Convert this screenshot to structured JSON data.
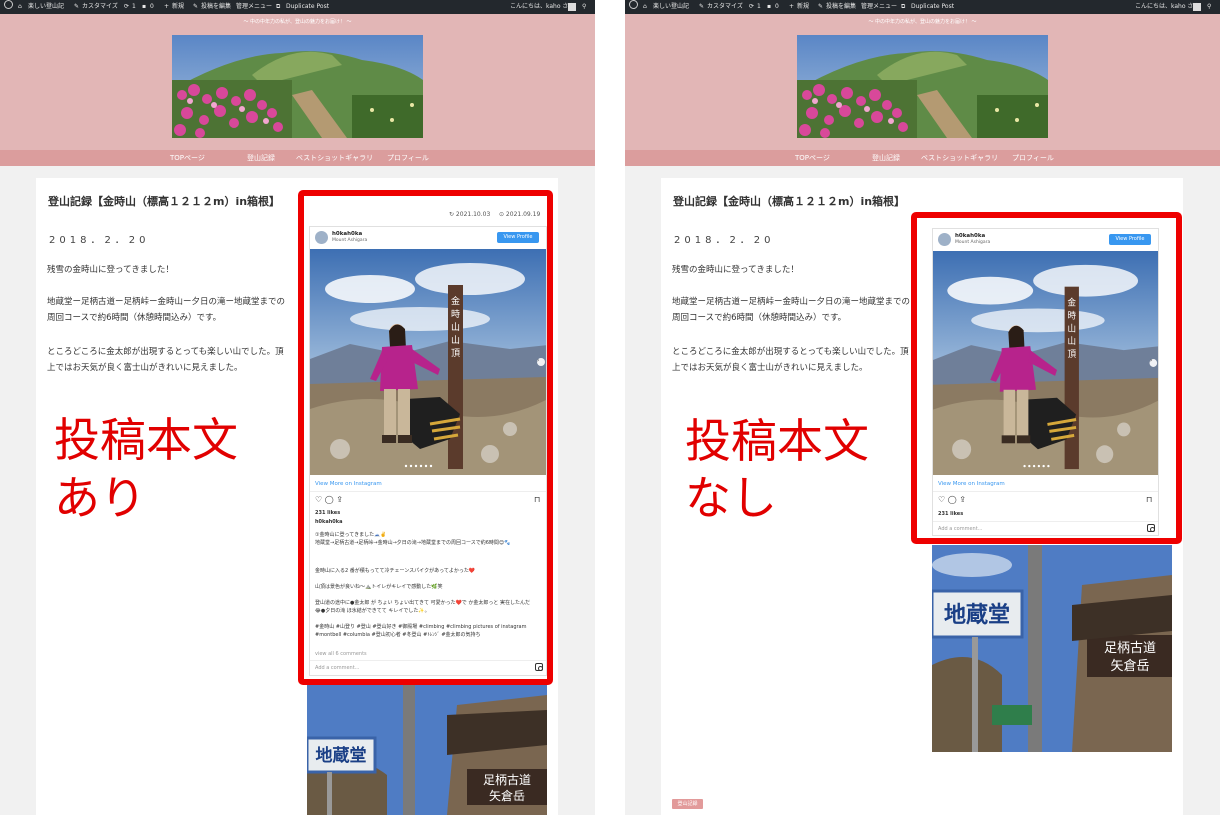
{
  "left": {
    "adminbar": {
      "site_name": "楽しい登山記",
      "customize": "カスタマイズ",
      "updates": "1",
      "comments": "0",
      "new": "新規",
      "edit": "投稿を編集",
      "menu": "管理メニュー",
      "duplicate": "Duplicate Post",
      "greeting": "こんにちは、kaho さん"
    },
    "tagline": "〜 中の中年力の私が、登山の魅力をお届け！ 〜",
    "nav": [
      "TOPページ",
      "登山記録",
      "ベストショットギャラリ",
      "プロフィール"
    ],
    "post": {
      "title": "登山記録【金時山（標高１２１２m）in箱根】",
      "date": "2018．2．20",
      "p1": "残雪の金時山に登ってきました！",
      "p2": "地蔵堂ー足柄古道ー足柄峠ー金時山ー夕日の滝ー地蔵堂までの周回コースで約6時間（休憩時間込み）です。",
      "p3": "ところどころに金太郎が出現するとっても楽しい山でした。頂上ではお天気が良く富士山がきれいに見えました。"
    },
    "annotation_line1": "投稿本文",
    "annotation_line2": "あり",
    "meta_updated": "↻ 2021.10.03",
    "meta_published": "⊙ 2021.09.19",
    "instagram": {
      "username": "h0kah0ka",
      "location": "Mount Ashigara",
      "view_profile": "View Profile",
      "view_more": "View More on Instagram",
      "likes": "231 likes",
      "caption_user": "h0kah0ka",
      "caption_1": "①金時山に登ってきました🗻✌️",
      "caption_2": "地蔵堂→足柄古道→足柄峠→金時山→夕日の滝→地蔵堂までの周回コースで約6時間😊🐾",
      "caption_3": "金時山に入る2 番が積もってて冷チェーンスパイクがあってよかった❤️",
      "caption_4": "山頂は景色が良いね〜⛰️トイレがキレイで感動した🌿笑",
      "caption_5": "登山道の途中に●金太郎 が ちょい ちょい出てきて 可愛かった❤️で か金太郎っと 実在したんだ😂●夕日の滝 ほ氷結ができてて キレイでした✨。",
      "caption_tags": "#金時山 #山登り #登山 #登山好き #御殿場 #climbing #climbing pictures of instagram #montbell #columbia #登山初心者 #冬登山 #ﾄﾚﾝｼﾞ #金太郎の気持ち",
      "view_comments": "view all 6 comments",
      "add_comment": "Add a comment...",
      "sign_text": "金時山山頂",
      "jizo_sign": "地蔵堂",
      "road_sign_1": "足柄古道",
      "road_sign_2": "矢倉岳"
    }
  },
  "right": {
    "adminbar": {
      "site_name": "楽しい登山記",
      "customize": "カスタマイズ",
      "updates": "1",
      "comments": "0",
      "new": "新規",
      "edit": "投稿を編集",
      "menu": "管理メニュー",
      "duplicate": "Duplicate Post",
      "greeting": "こんにちは、kaho さん"
    },
    "tagline": "〜 中の中年力の私が、登山の魅力をお届け！ 〜",
    "nav": [
      "TOPページ",
      "登山記録",
      "ベストショットギャラリ",
      "プロフィール"
    ],
    "post": {
      "title": "登山記録【金時山（標高１２１２m）in箱根】",
      "date": "2018．2．20",
      "p1": "残雪の金時山に登ってきました！",
      "p2": "地蔵堂ー足柄古道ー足柄峠ー金時山ー夕日の滝ー地蔵堂までの周回コースで約6時間（休憩時間込み）です。",
      "p3": "ところどころに金太郎が出現するとっても楽しい山でした。頂上ではお天気が良く富士山がきれいに見えました。"
    },
    "annotation_line1": "投稿本文",
    "annotation_line2": "なし",
    "instagram": {
      "username": "h0kah0ka",
      "location": "Mount Ashigara",
      "view_profile": "View Profile",
      "view_more": "View More on Instagram",
      "likes": "231 likes",
      "add_comment": "Add a comment...",
      "jizo_sign": "地蔵堂",
      "road_sign_1": "足柄古道",
      "road_sign_2": "矢倉岳"
    },
    "category_tag": "登山記録"
  }
}
